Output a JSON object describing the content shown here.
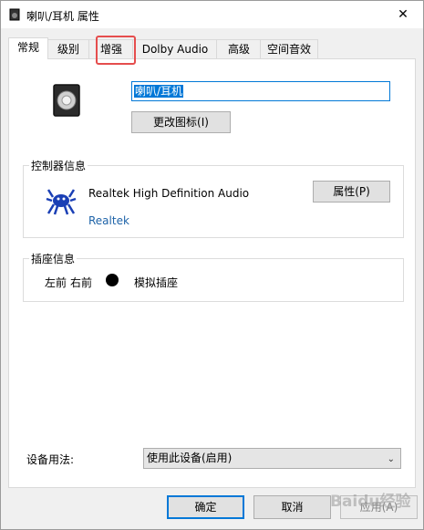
{
  "window": {
    "title": "喇叭/耳机 属性",
    "close_glyph": "✕"
  },
  "tabs": [
    {
      "label": "常规",
      "active": true
    },
    {
      "label": "级别"
    },
    {
      "label": "增强",
      "highlighted": true
    },
    {
      "label": "Dolby Audio"
    },
    {
      "label": "高级"
    },
    {
      "label": "空间音效"
    }
  ],
  "general": {
    "device_name_value": "喇叭/耳机",
    "change_icon_label": "更改图标(I)"
  },
  "controller": {
    "group_label": "控制器信息",
    "device_name": "Realtek High Definition Audio",
    "vendor_link": "Realtek",
    "properties_label": "属性(P)"
  },
  "jack": {
    "group_label": "插座信息",
    "front_left": "左前",
    "front_right": "右前",
    "type": "模拟插座"
  },
  "usage": {
    "label": "设备用法:",
    "selected": "使用此设备(启用)"
  },
  "footer": {
    "ok_label": "确定",
    "cancel_label": "取消",
    "apply_label": "应用(A)"
  },
  "watermark": {
    "text": "Baidu经验"
  },
  "colors": {
    "accent": "#0078d7",
    "highlight_box": "#e54d4d",
    "link": "#1e63a8"
  }
}
